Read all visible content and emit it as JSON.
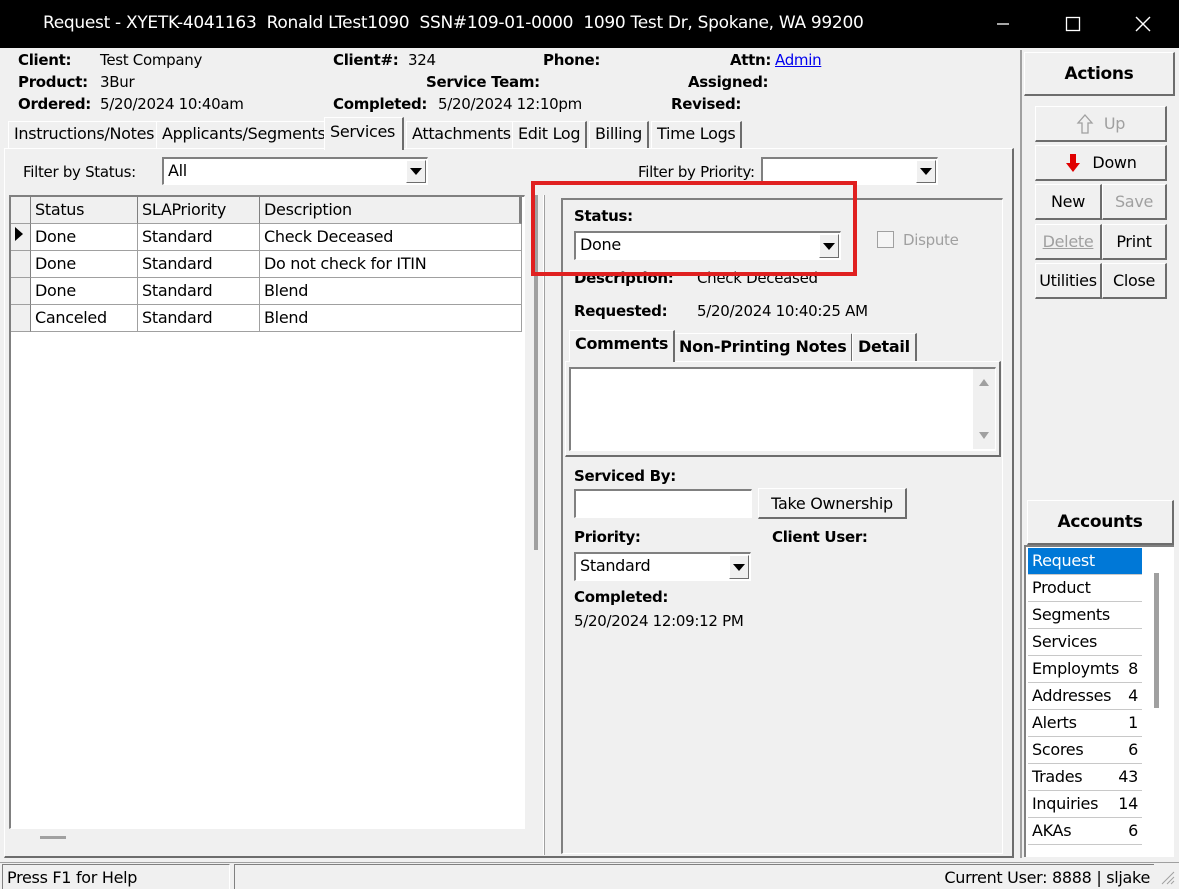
{
  "window": {
    "title": "Request - XYETK-4041163  Ronald LTest1090  SSN#109-01-0000  1090 Test Dr, Spokane, WA 99200"
  },
  "header": {
    "client_label": "Client:",
    "client_value": "Test Company",
    "product_label": "Product:",
    "product_value": "3Bur",
    "ordered_label": "Ordered:",
    "ordered_value": "5/20/2024 10:40am",
    "clientno_label": "Client#:",
    "clientno_value": "324",
    "phone_label": "Phone:",
    "service_team_label": "Service Team:",
    "completed_label": "Completed:",
    "completed_value": "5/20/2024 12:10pm",
    "attn_label": "Attn:",
    "attn_value": "Admin",
    "assigned_label": "Assigned:",
    "revised_label": "Revised:"
  },
  "tabs": [
    "Instructions/Notes",
    "Applicants/Segments",
    "Services",
    "Attachments",
    "Edit Log",
    "Billing",
    "Time Logs"
  ],
  "filters": {
    "status_label": "Filter by Status:",
    "status_value": "All",
    "priority_label": "Filter by Priority:",
    "priority_value": ""
  },
  "grid": {
    "columns": [
      "Status",
      "SLAPriority",
      "Description"
    ],
    "rows": [
      {
        "status": "Done",
        "priority": "Standard",
        "description": "Check Deceased"
      },
      {
        "status": "Done",
        "priority": "Standard",
        "description": "Do not check for ITIN"
      },
      {
        "status": "Done",
        "priority": "Standard",
        "description": "Blend"
      },
      {
        "status": "Canceled",
        "priority": "Standard",
        "description": "Blend"
      }
    ]
  },
  "detail": {
    "status_label": "Status:",
    "status_value": "Done",
    "dispute_label": "Dispute",
    "description_label": "Description:",
    "description_value": "Check Deceased",
    "requested_label": "Requested:",
    "requested_value": "5/20/2024 10:40:25 AM",
    "subtabs": [
      "Comments",
      "Non-Printing Notes",
      "Detail"
    ],
    "serviced_by_label": "Serviced By:",
    "serviced_by_value": "",
    "take_ownership_label": "Take Ownership",
    "priority_label": "Priority:",
    "priority_value": "Standard",
    "client_user_label": "Client User:",
    "completed_label": "Completed:",
    "completed_value": "5/20/2024 12:09:12 PM"
  },
  "actions": {
    "title": "Actions",
    "up": "Up",
    "down": "Down",
    "new": "New",
    "save": "Save",
    "delete": "Delete",
    "print": "Print",
    "utilities": "Utilities",
    "close": "Close"
  },
  "accounts": {
    "title": "Accounts",
    "items": [
      {
        "label": "Request",
        "count": ""
      },
      {
        "label": "Product",
        "count": ""
      },
      {
        "label": "Segments",
        "count": ""
      },
      {
        "label": "Services",
        "count": ""
      },
      {
        "label": "Employmts",
        "count": "8"
      },
      {
        "label": "Addresses",
        "count": "4"
      },
      {
        "label": "Alerts",
        "count": "1"
      },
      {
        "label": "Scores",
        "count": "6"
      },
      {
        "label": "Trades",
        "count": "43"
      },
      {
        "label": "Inquiries",
        "count": "14"
      },
      {
        "label": "AKAs",
        "count": "6"
      }
    ]
  },
  "statusbar": {
    "help": "Press F1 for Help",
    "user": "Current User: 8888 | sljake"
  },
  "colors": {
    "titlebar": "#000000",
    "highlight": "#0078d7",
    "annotation": "#e02020",
    "link": "#0000ee"
  }
}
